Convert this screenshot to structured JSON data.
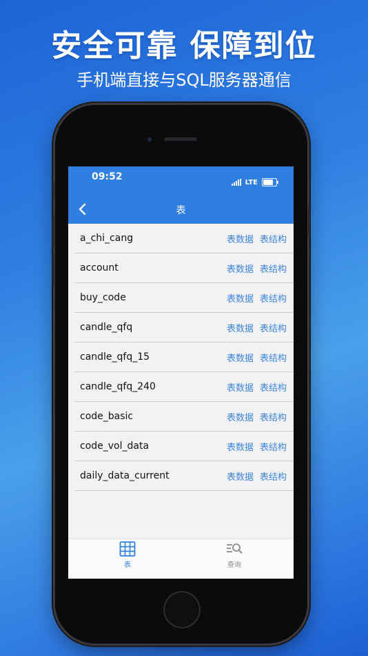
{
  "promo": {
    "headline": "安全可靠  保障到位",
    "subline": "手机端直接与SQL服务器通信"
  },
  "status_bar": {
    "time": "09:52",
    "network": "LTE",
    "battery_level": 0.85
  },
  "nav": {
    "title": "表",
    "back_icon": "chevron-left-icon"
  },
  "row_actions": {
    "data_label": "表数据",
    "structure_label": "表结构"
  },
  "tables": [
    {
      "name": "a_chi_cang"
    },
    {
      "name": "account"
    },
    {
      "name": "buy_code"
    },
    {
      "name": "candle_qfq"
    },
    {
      "name": "candle_qfq_15"
    },
    {
      "name": "candle_qfq_240"
    },
    {
      "name": "code_basic"
    },
    {
      "name": "code_vol_data"
    },
    {
      "name": "daily_data_current"
    }
  ],
  "tabbar": {
    "tabs": [
      {
        "label": "表",
        "icon": "grid-table-icon",
        "active": true
      },
      {
        "label": "查询",
        "icon": "search-list-icon",
        "active": false
      }
    ]
  },
  "colors": {
    "accent": "#2f7fe0",
    "link": "#3c86e0",
    "inactive": "#8a8a8a"
  }
}
